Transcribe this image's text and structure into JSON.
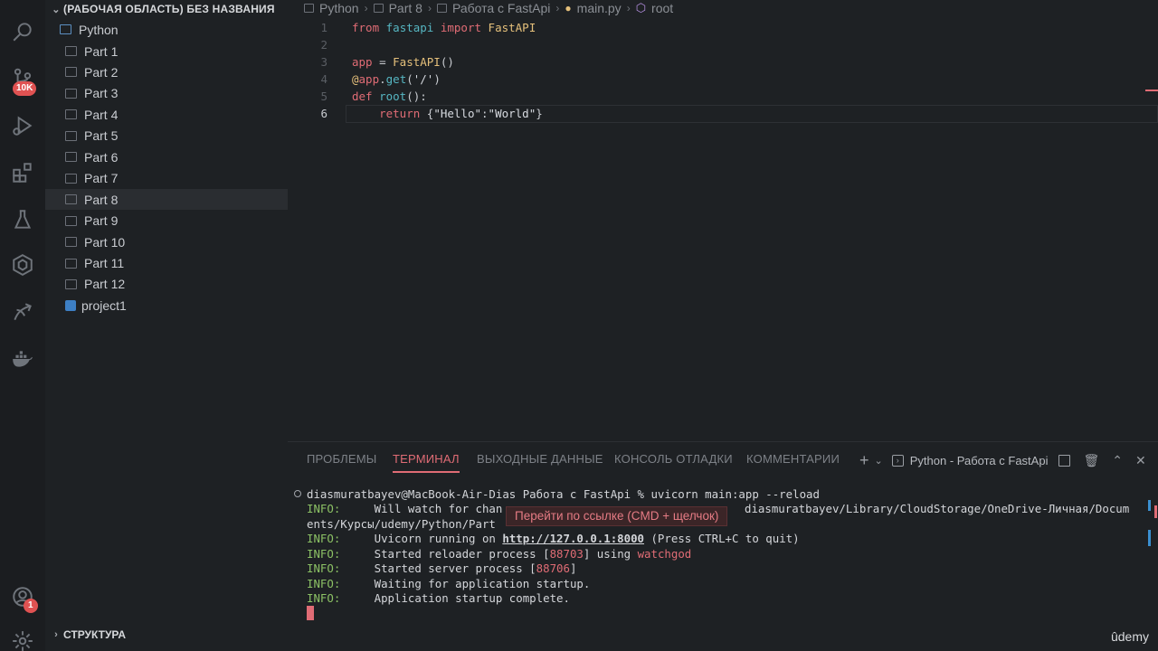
{
  "activity_bar": {
    "icons": [
      "search-icon",
      "source-control-icon",
      "run-debug-icon",
      "extensions-icon",
      "testing-icon",
      "remote-icon",
      "accounts-icon",
      "docker-icon",
      "account-icon",
      "settings-icon"
    ],
    "source_control_badge": "10K",
    "account_badge": "1"
  },
  "sidebar": {
    "workspace_title": "(РАБОЧАЯ ОБЛАСТЬ) БЕЗ НАЗВАНИЯ",
    "root_folder": "Python",
    "items": [
      {
        "label": "Part 1"
      },
      {
        "label": "Part 2"
      },
      {
        "label": "Part 3"
      },
      {
        "label": "Part 4"
      },
      {
        "label": "Part 5"
      },
      {
        "label": "Part 6"
      },
      {
        "label": "Part 7"
      },
      {
        "label": "Part 8"
      },
      {
        "label": "Part 9"
      },
      {
        "label": "Part 10"
      },
      {
        "label": "Part 11"
      },
      {
        "label": "Part 12"
      }
    ],
    "selected": "Part 8",
    "project": "project1",
    "structure_title": "СТРУКТУРА"
  },
  "breadcrumb": [
    "Python",
    "Part 8",
    "Работа с FastApi",
    "main.py",
    "root"
  ],
  "editor": {
    "line_numbers": [
      "1",
      "2",
      "3",
      "4",
      "5",
      "6"
    ],
    "active_line": "6"
  },
  "panel": {
    "tabs": [
      "ПРОБЛЕМЫ",
      "ТЕРМИНАЛ",
      "ВЫХОДНЫЕ ДАННЫЕ",
      "КОНСОЛЬ ОТЛАДКИ",
      "КОММЕНТАРИИ"
    ],
    "active_tab": "ТЕРМИНАЛ",
    "terminal_name": "Python - Работа с FastApi",
    "tooltip": "Перейти по ссылке (CMD + щелчок)",
    "terminal": {
      "prompt": "diasmuratbayev@MacBook-Air-Dias Работа с FastApi % uvicorn main:app --reload",
      "info_label": "INFO:",
      "watch_a": "     Will watch for chan",
      "watch_b": "diasmuratbayev/Library/CloudStorage/OneDrive-Личная/Docum",
      "watch_c": "ents/Курсы/udemy/Python/Part",
      "running_prefix": "     Uvicorn running on ",
      "url": "http://127.0.0.1:8000",
      "running_suffix": " (Press CTRL+C to quit)",
      "reloader_prefix": "     Started reloader process [",
      "reloader_pid": "88703",
      "reloader_mid": "] using ",
      "reloader_tool": "watchgod",
      "server_prefix": "     Started server process [",
      "server_pid": "88706",
      "server_suffix": "]",
      "waiting": "     Waiting for application startup.",
      "complete": "     Application startup complete."
    }
  },
  "watermark": "ûdemy"
}
